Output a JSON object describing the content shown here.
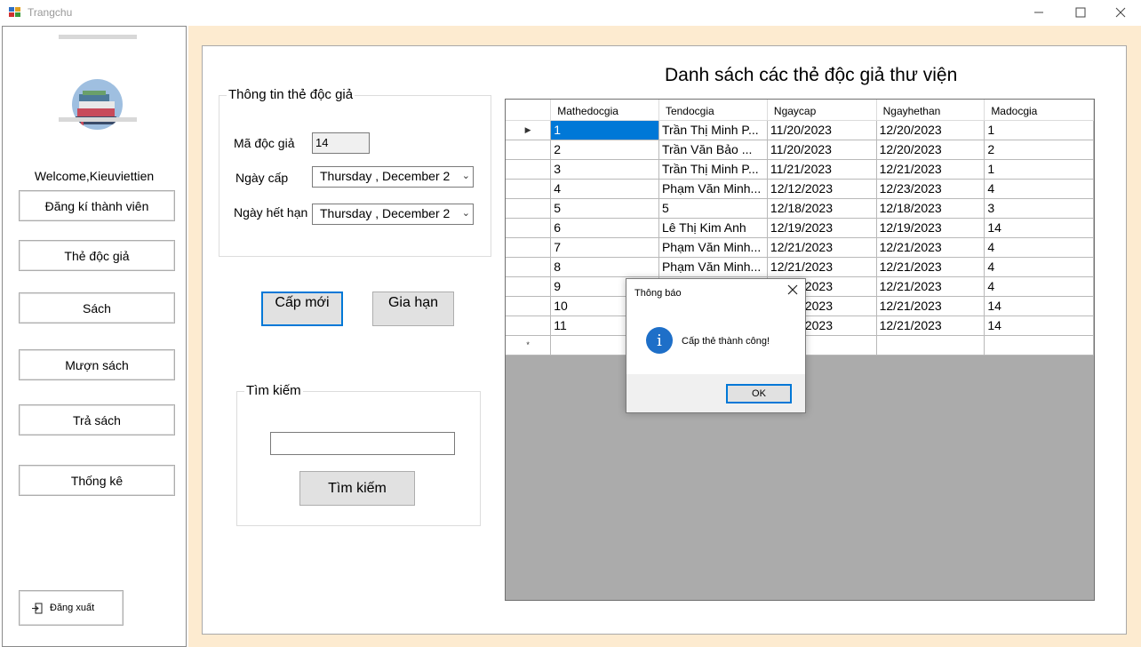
{
  "window": {
    "title": "Trangchu",
    "minimize": "—",
    "maximize": "☐",
    "close": "✕"
  },
  "sidebar": {
    "welcome": "Welcome,Kieuviettien",
    "items": [
      {
        "label": "Đăng kí thành viên"
      },
      {
        "label": "Thẻ độc giả"
      },
      {
        "label": "Sách"
      },
      {
        "label": "Mượn sách"
      },
      {
        "label": "Trả sách"
      },
      {
        "label": "Thống kê"
      }
    ],
    "logout_label": "Đăng xuất",
    "logout_icon": "logout-icon",
    "avatar_icon": "books-stack-icon"
  },
  "card_info": {
    "legend": "Thông tin thẻ độc giả",
    "id_label": "Mã độc giả",
    "id_value": "14",
    "issue_label": "Ngày cấp",
    "issue_value": "Thursday  ,  December  2",
    "expiry_label": "Ngày hết hạn",
    "expiry_value": "Thursday  ,  December  2"
  },
  "actions": {
    "new_label": "Cấp mới",
    "renew_label": "Gia hạn"
  },
  "search": {
    "legend": "Tìm kiếm",
    "value": "",
    "button_label": "Tìm kiếm"
  },
  "grid": {
    "title": "Danh sách các thẻ độc giả thư viện",
    "columns": [
      "Mathedocgia",
      "Tendocgia",
      "Ngaycap",
      "Ngayhethan",
      "Madocgia"
    ],
    "rows": [
      [
        "1",
        "Trần Thị Minh P...",
        "11/20/2023",
        "12/20/2023",
        "1"
      ],
      [
        "2",
        "Trần Văn Bảo ...",
        "11/20/2023",
        "12/20/2023",
        "2"
      ],
      [
        "3",
        "Trần Thị Minh P...",
        "11/21/2023",
        "12/21/2023",
        "1"
      ],
      [
        "4",
        "Phạm Văn Minh...",
        "12/12/2023",
        "12/23/2023",
        "4"
      ],
      [
        "5",
        "5",
        "12/18/2023",
        "12/18/2023",
        "3"
      ],
      [
        "6",
        "Lê Thị Kim Anh",
        "12/19/2023",
        "12/19/2023",
        "14"
      ],
      [
        "7",
        "Phạm Văn Minh...",
        "12/21/2023",
        "12/21/2023",
        "4"
      ],
      [
        "8",
        "Phạm Văn Minh...",
        "12/21/2023",
        "12/21/2023",
        "4"
      ],
      [
        "9",
        "",
        "12/21/2023",
        "12/21/2023",
        "4"
      ],
      [
        "10",
        "",
        "12/21/2023",
        "12/21/2023",
        "14"
      ],
      [
        "11",
        "",
        "12/21/2023",
        "12/21/2023",
        "14"
      ]
    ],
    "current_row_marker": "▶",
    "new_row_marker": "*"
  },
  "dialog": {
    "title": "Thông báo",
    "message": "Cấp  thẻ thành công!",
    "ok_label": "OK",
    "icon": "info-icon",
    "info_glyph": "i"
  },
  "colors": {
    "main_bg": "#fdebd0",
    "selection": "#0078d7",
    "grid_empty": "#ababab"
  }
}
